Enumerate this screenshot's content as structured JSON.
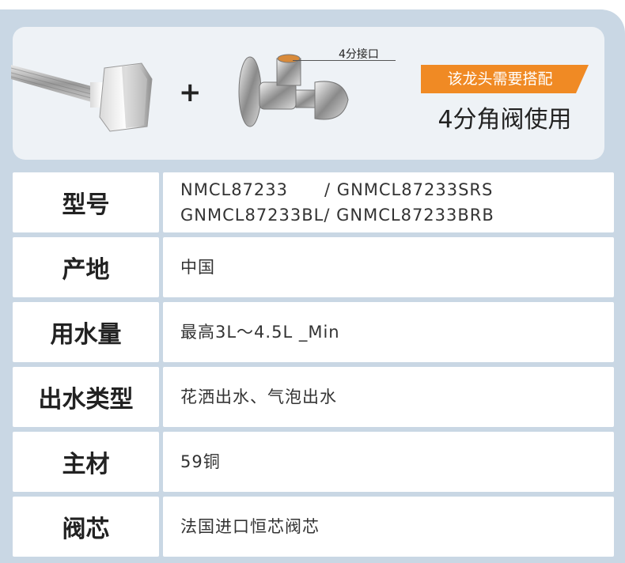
{
  "top": {
    "plus": "+",
    "connector_label": "4分接口",
    "badge": "该龙头需要搭配",
    "subtitle": "4分角阀使用",
    "badge_color": "#f08a24"
  },
  "specs": [
    {
      "label": "型号",
      "lines": [
        "NMCL87233      / GNMCL87233SRS",
        "GNMCL87233BL/ GNMCL87233BRB"
      ]
    },
    {
      "label": "产地",
      "lines": [
        "中国"
      ]
    },
    {
      "label": "用水量",
      "lines": [
        "最高3L～4.5L _Min"
      ]
    },
    {
      "label": "出水类型",
      "lines": [
        "花洒出水、气泡出水"
      ]
    },
    {
      "label": "主材",
      "lines": [
        "59铜"
      ]
    },
    {
      "label": "阀芯",
      "lines": [
        "法国进口恒芯阀芯"
      ]
    }
  ]
}
